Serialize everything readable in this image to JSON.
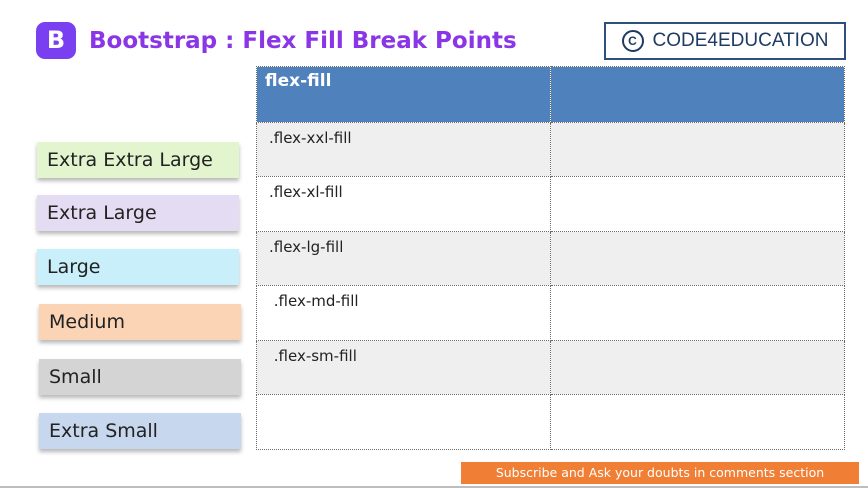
{
  "header": {
    "logo_letter": "B",
    "title": "Bootstrap :  Flex Fill Break Points",
    "brand_text": "CODE4EDUCATION",
    "brand_symbol": "C"
  },
  "breakpoints": [
    {
      "label": "Extra Extra Large",
      "color": "#e2f5cf"
    },
    {
      "label": "Extra Large",
      "color": "#e4dcf3"
    },
    {
      "label": "Large",
      "color": "#c8effa"
    },
    {
      "label": "Medium",
      "color": "#fbd3b5"
    },
    {
      "label": "Small",
      "color": "#d4d4d4"
    },
    {
      "label": "Extra Small",
      "color": "#c6d7ee"
    }
  ],
  "table": {
    "headers": [
      "flex-fill",
      ""
    ],
    "rows": [
      [
        ".flex-xxl-fill",
        ""
      ],
      [
        ".flex-xl-fill",
        ""
      ],
      [
        ".flex-lg-fill",
        ""
      ],
      [
        " .flex-md-fill",
        ""
      ],
      [
        " .flex-sm-fill",
        ""
      ],
      [
        "",
        ""
      ]
    ]
  },
  "footer": {
    "subscribe_text": "Subscribe and Ask your doubts in comments section"
  },
  "colors": {
    "accent": "#8a35e6",
    "logo_bg": "#7b3ff2",
    "table_header": "#4f81bd",
    "subscribe_bg": "#f07f35"
  }
}
